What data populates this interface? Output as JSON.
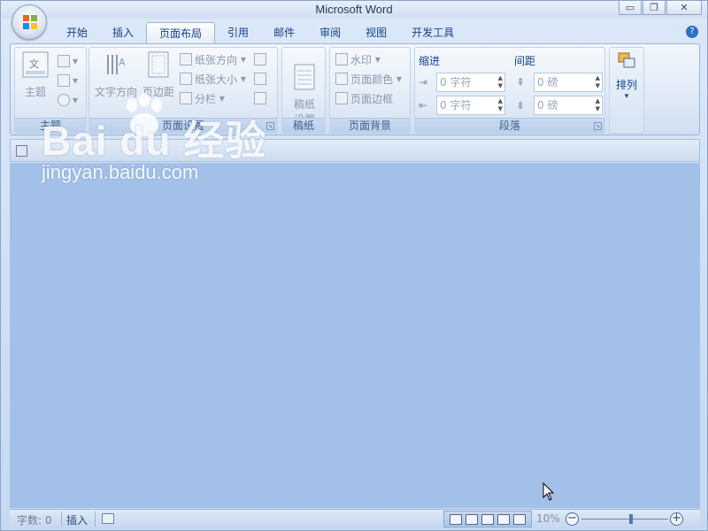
{
  "window": {
    "title": "Microsoft Word",
    "minimize_label": "▭",
    "restore_label": "❐",
    "close_label": "✕"
  },
  "tabs": [
    {
      "label": "开始",
      "active": false
    },
    {
      "label": "插入",
      "active": false
    },
    {
      "label": "页面布局",
      "active": true
    },
    {
      "label": "引用",
      "active": false
    },
    {
      "label": "邮件",
      "active": false
    },
    {
      "label": "审阅",
      "active": false
    },
    {
      "label": "视图",
      "active": false
    },
    {
      "label": "开发工具",
      "active": false
    }
  ],
  "ribbon": {
    "themes": {
      "group_label": "主题",
      "theme_button": "主题"
    },
    "page_setup": {
      "group_label": "页面设置",
      "text_direction": "文字方向",
      "margins": "页边距",
      "orientation": "纸张方向",
      "size": "纸张大小",
      "columns": "分栏"
    },
    "draft_paper": {
      "group_label": "稿纸",
      "button": "稿纸\n设置"
    },
    "page_background": {
      "group_label": "页面背景",
      "watermark": "水印",
      "page_color": "页面颜色",
      "page_border": "页面边框"
    },
    "paragraph": {
      "group_label": "段落",
      "indent_title": "缩进",
      "spacing_title": "间距",
      "indent_left": "0 字符",
      "indent_right": "0 字符",
      "spacing_before": "0 磅",
      "spacing_after": "0 磅"
    },
    "arrange": {
      "button": "排列"
    }
  },
  "status": {
    "word_count": "字数: 0",
    "mode": "插入",
    "zoom": "10%"
  },
  "watermark": {
    "logo": "Bai  du 经验",
    "url": "jingyan.baidu.com"
  }
}
